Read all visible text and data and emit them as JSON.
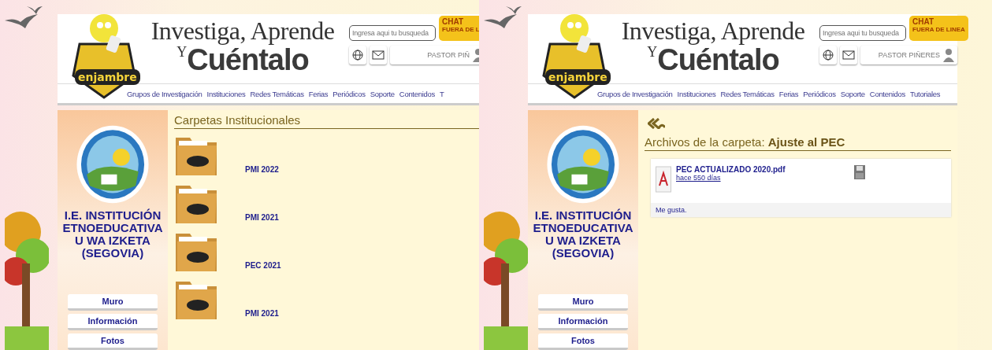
{
  "screens": [
    {
      "kind": "folders",
      "header": {
        "logo_text": "enjambre",
        "title_top": "Investiga, Aprende",
        "title_y": "Y",
        "title_main": "Cuéntalo",
        "search": {
          "placeholder": "Ingresa aqui tu busqueda"
        },
        "chat": {
          "title": "CHAT",
          "subtitle": "FUERA DE L"
        },
        "user": "PASTOR PIÑ"
      },
      "nav": [
        "Grupos de Investigación",
        "Instituciones",
        "Redes Temáticas",
        "Ferias",
        "Periódicos",
        "Soporte",
        "Contenidos",
        "T"
      ],
      "sidebar": {
        "name": "I.E. INSTITUCIÓN ETNOEDUCATIVA U WA IZKETA (SEGOVIA)",
        "menu": [
          "Muro",
          "Información",
          "Fotos"
        ]
      },
      "content": {
        "title": "Carpetas Institucionales",
        "folders": [
          {
            "name": "PMI 2022"
          },
          {
            "name": "PMI 2021"
          },
          {
            "name": "PEC 2021"
          },
          {
            "name": "PMI 2021"
          }
        ]
      }
    },
    {
      "kind": "files",
      "header": {
        "logo_text": "enjambre",
        "title_top": "Investiga, Aprende",
        "title_y": "Y",
        "title_main": "Cuéntalo",
        "search": {
          "placeholder": "Ingresa aqui tu busqueda"
        },
        "chat": {
          "title": "CHAT",
          "subtitle": "FUERA DE LINEA"
        },
        "user": "PASTOR PIÑERES"
      },
      "nav": [
        "Grupos de Investigación",
        "Instituciones",
        "Redes Temáticas",
        "Ferias",
        "Periódicos",
        "Soporte",
        "Contenidos",
        "Tutoriales"
      ],
      "sidebar": {
        "name": "I.E. INSTITUCIÓN ETNOEDUCATIVA U WA IZKETA (SEGOVIA)",
        "menu": [
          "Muro",
          "Información",
          "Fotos"
        ]
      },
      "content": {
        "title": "Archivos de la carpeta: **Ajuste al PEC**",
        "files": [
          {
            "name": "PEC ACTUALIZADO 2020.pdf",
            "age": "hace 550 días",
            "like": "Me gusta."
          }
        ]
      }
    }
  ]
}
